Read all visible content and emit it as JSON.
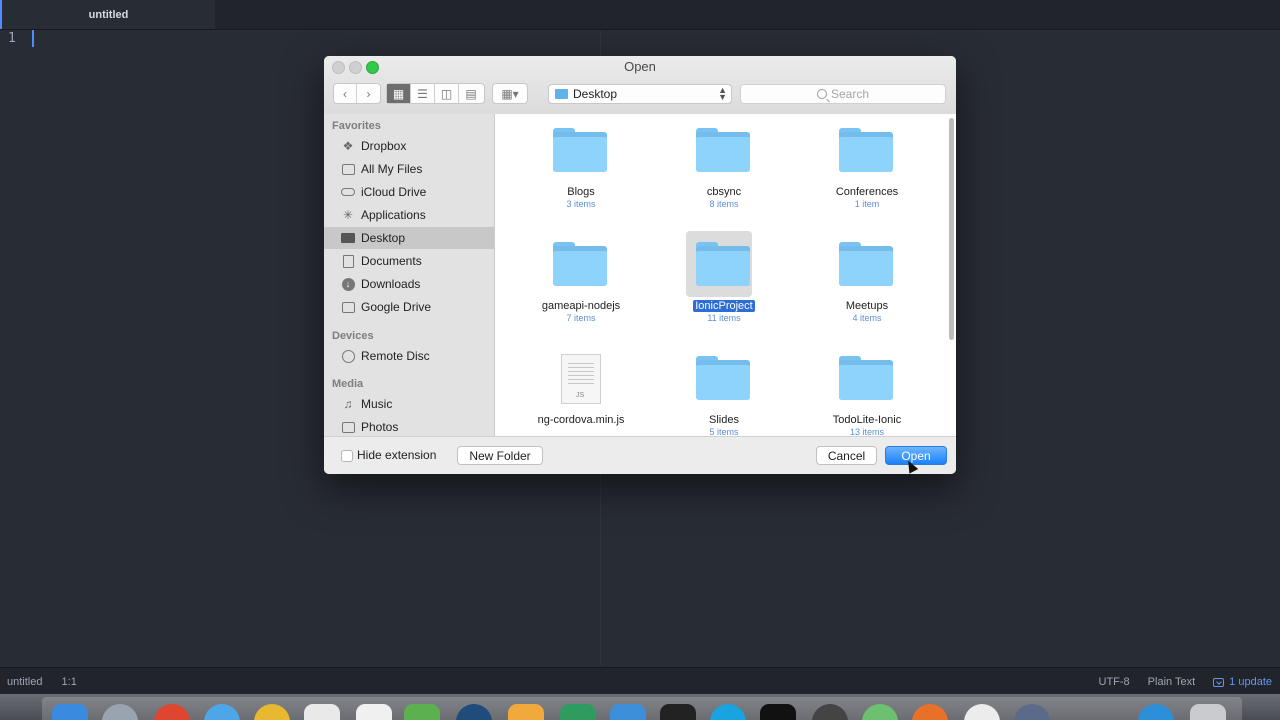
{
  "editor": {
    "tab_title": "untitled",
    "line_number": "1"
  },
  "statusbar": {
    "file": "untitled",
    "position": "1:1",
    "encoding": "UTF-8",
    "grammar": "Plain Text",
    "update": "1 update"
  },
  "dialog": {
    "title": "Open",
    "location": "Desktop",
    "search_placeholder": "Search",
    "sidebar": {
      "favorites_header": "Favorites",
      "favorites": [
        {
          "label": "Dropbox",
          "icon": "dropbox-icon"
        },
        {
          "label": "All My Files",
          "icon": "all-files-icon"
        },
        {
          "label": "iCloud Drive",
          "icon": "cloud-icon"
        },
        {
          "label": "Applications",
          "icon": "applications-icon"
        },
        {
          "label": "Desktop",
          "icon": "desktop-icon",
          "selected": true
        },
        {
          "label": "Documents",
          "icon": "documents-icon"
        },
        {
          "label": "Downloads",
          "icon": "downloads-icon"
        },
        {
          "label": "Google Drive",
          "icon": "folder-icon"
        }
      ],
      "devices_header": "Devices",
      "devices": [
        {
          "label": "Remote Disc",
          "icon": "disc-icon"
        }
      ],
      "media_header": "Media",
      "media": [
        {
          "label": "Music",
          "icon": "music-icon"
        },
        {
          "label": "Photos",
          "icon": "photos-icon"
        }
      ]
    },
    "files": [
      {
        "name": "Blogs",
        "count": "3 items"
      },
      {
        "name": "cbsync",
        "count": "8 items"
      },
      {
        "name": "Conferences",
        "count": "1 item"
      },
      {
        "name": "gameapi-nodejs",
        "count": "7 items"
      },
      {
        "name": "IonicProject",
        "count": "11 items",
        "selected": true
      },
      {
        "name": "Meetups",
        "count": "4 items"
      },
      {
        "name": "ng-cordova.min.js",
        "count": "",
        "type": "file",
        "ext": "JS"
      },
      {
        "name": "Slides",
        "count": "5 items"
      },
      {
        "name": "TodoLite-Ionic",
        "count": "13 items"
      }
    ],
    "footer": {
      "hide_extension": "Hide extension",
      "new_folder": "New Folder",
      "cancel": "Cancel",
      "open": "Open"
    }
  },
  "colors": {
    "editor_bg": "#282c34",
    "accent": "#528bff",
    "primary_button": "#1a82fb",
    "folder": "#8ed3fb"
  }
}
